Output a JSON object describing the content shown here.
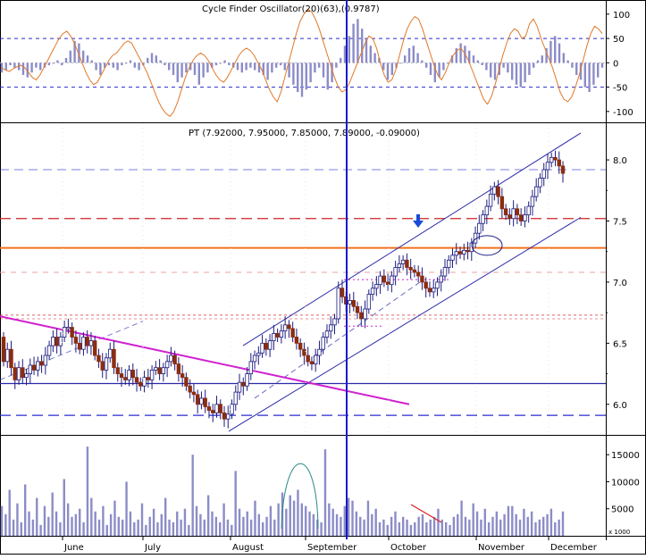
{
  "panels": {
    "oscillator": {
      "title": "Cycle Finder Oscillator(20)(63),(0.9787)",
      "yticks": [
        -100,
        -50,
        0,
        50,
        100
      ],
      "ylim": [
        -115,
        118
      ],
      "levels": [
        50,
        -50
      ]
    },
    "price": {
      "title": "PT (7.92000, 7.95000, 7.85000, 7.89000, -0.09000)",
      "yticks": [
        "6.0",
        "6.5",
        "7.0",
        "7.5",
        "8.0"
      ],
      "ylim": [
        5.75,
        8.3
      ]
    },
    "volume": {
      "yticks": [
        5000,
        10000,
        15000
      ],
      "ylim": [
        0,
        18500
      ],
      "unit": "x 1000"
    }
  },
  "x_axis": {
    "months": [
      "June",
      "July",
      "August",
      "September",
      "October",
      "November",
      "December"
    ]
  },
  "colors": {
    "up": "#ffffff",
    "down": "#8b2d10",
    "wick": "#1b1b80",
    "channel": "#2a2aa8",
    "downtrend": "#d020d0",
    "resistance": "#f0701e",
    "dashed_red": "#cc2222",
    "dashed_blue": "#2a2acc",
    "cursor": "#1a1ac8",
    "osc_line": "#e07828",
    "osc_bar": "#8c8cc8",
    "vol_bar": "#8c8cc8",
    "annotation_red": "#dd2020",
    "annotation_teal": "#2a8a8a"
  },
  "chart_data": [
    {
      "type": "bar",
      "name": "oscillator",
      "title": "Cycle Finder Oscillator(20)(63),(0.9787)",
      "ylim": [
        -115,
        118
      ],
      "line": [
        -10,
        -15,
        -18,
        -12,
        -8,
        -5,
        -10,
        -20,
        -30,
        -35,
        -25,
        -10,
        5,
        20,
        35,
        50,
        60,
        65,
        55,
        40,
        20,
        0,
        -20,
        -35,
        -45,
        -40,
        -25,
        -10,
        5,
        15,
        20,
        30,
        40,
        45,
        40,
        25,
        10,
        -5,
        -20,
        -40,
        -60,
        -80,
        -95,
        -105,
        -110,
        -100,
        -80,
        -55,
        -30,
        -10,
        5,
        15,
        20,
        15,
        5,
        -10,
        -25,
        -35,
        -40,
        -30,
        -15,
        0,
        15,
        25,
        30,
        25,
        15,
        0,
        -15,
        -35,
        -55,
        -70,
        -80,
        -60,
        -30,
        0,
        30,
        60,
        85,
        100,
        110,
        105,
        90,
        70,
        45,
        20,
        -5,
        -30,
        -50,
        -60,
        -55,
        -40,
        -20,
        0,
        20,
        40,
        55,
        50,
        30,
        0,
        -25,
        -40,
        -35,
        -15,
        15,
        45,
        70,
        85,
        95,
        90,
        70,
        45,
        20,
        -5,
        -25,
        -35,
        -20,
        0,
        15,
        25,
        30,
        20,
        5,
        -15,
        -35,
        -55,
        -75,
        -85,
        -70,
        -45,
        -15,
        15,
        40,
        60,
        70,
        65,
        50,
        55,
        80,
        90,
        75,
        50,
        30,
        10,
        -10,
        -35,
        -60,
        -75,
        -80,
        -70,
        -50,
        -25,
        5,
        35,
        60,
        75,
        70,
        60
      ],
      "bars": [
        -20,
        -15,
        -5,
        -10,
        -15,
        -25,
        -30,
        -20,
        -10,
        -15,
        -10,
        -5,
        0,
        5,
        -5,
        10,
        25,
        45,
        40,
        25,
        15,
        5,
        -15,
        -25,
        -10,
        -5,
        -10,
        -15,
        -5,
        0,
        5,
        -10,
        -15,
        -5,
        10,
        20,
        15,
        5,
        -5,
        -15,
        -25,
        -40,
        -30,
        -20,
        -15,
        -25,
        -45,
        -30,
        -20,
        -10,
        -5,
        0,
        5,
        -5,
        -10,
        -15,
        -20,
        -15,
        -10,
        -15,
        -20,
        -25,
        -35,
        -20,
        -10,
        -5,
        -15,
        -30,
        -45,
        -60,
        -70,
        -55,
        -40,
        -20,
        -10,
        -30,
        -55,
        -40,
        -10,
        10,
        35,
        55,
        80,
        90,
        70,
        50,
        35,
        20,
        10,
        -15,
        -35,
        -25,
        -10,
        0,
        15,
        30,
        35,
        20,
        5,
        -10,
        -25,
        -40,
        -30,
        -15,
        0,
        15,
        30,
        40,
        35,
        25,
        15,
        5,
        -5,
        -15,
        -30,
        -35,
        -25,
        -10,
        -20,
        -35,
        -45,
        -50,
        -40,
        -25,
        -10,
        5,
        15,
        30,
        45,
        55,
        40,
        20,
        5,
        -10,
        -25,
        -35,
        -50,
        -60,
        -45,
        -30,
        -10
      ]
    },
    {
      "type": "candlestick",
      "name": "price",
      "title": "PT (7.92000, 7.95000, 7.85000, 7.89000, -0.09000)",
      "ylim": [
        5.75,
        8.3
      ],
      "open": [
        6.55,
        6.35,
        6.45,
        6.3,
        6.2,
        6.3,
        6.22,
        6.25,
        6.32,
        6.28,
        6.35,
        6.32,
        6.4,
        6.48,
        6.55,
        6.48,
        6.55,
        6.63,
        6.63,
        6.55,
        6.5,
        6.45,
        6.55,
        6.48,
        6.52,
        6.4,
        6.35,
        6.28,
        6.38,
        6.45,
        6.3,
        6.25,
        6.22,
        6.2,
        6.28,
        6.22,
        6.18,
        6.15,
        6.22,
        6.2,
        6.28,
        6.3,
        6.25,
        6.3,
        6.35,
        6.4,
        6.33,
        6.25,
        6.22,
        6.15,
        6.1,
        6.08,
        6.0,
        6.05,
        5.98,
        5.95,
        5.93,
        6.0,
        5.93,
        5.88,
        5.92,
        6.0,
        6.1,
        6.18,
        6.15,
        6.25,
        6.35,
        6.4,
        6.42,
        6.5,
        6.45,
        6.52,
        6.58,
        6.55,
        6.6,
        6.65,
        6.62,
        6.55,
        6.5,
        6.45,
        6.4,
        6.35,
        6.33,
        6.4,
        6.45,
        6.55,
        6.6,
        6.65,
        6.7,
        6.95,
        6.88,
        6.82,
        6.85,
        6.8,
        6.75,
        6.7,
        6.78,
        6.9,
        6.95,
        6.98,
        7.05,
        7.0,
        6.98,
        7.05,
        7.12,
        7.15,
        7.18,
        7.12,
        7.1,
        7.08,
        7.05,
        7.0,
        6.95,
        6.92,
        6.95,
        7.0,
        7.05,
        7.12,
        7.18,
        7.22,
        7.25,
        7.23,
        7.26,
        7.25,
        7.32,
        7.4,
        7.48,
        7.55,
        7.62,
        7.72,
        7.78,
        7.7,
        7.6,
        7.55,
        7.52,
        7.6,
        7.55,
        7.5,
        7.55,
        7.62,
        7.7,
        7.78,
        7.85,
        7.92,
        7.98,
        8.02,
        8.0,
        7.95
      ],
      "close": [
        6.35,
        6.45,
        6.3,
        6.2,
        6.3,
        6.22,
        6.25,
        6.32,
        6.28,
        6.35,
        6.32,
        6.4,
        6.48,
        6.55,
        6.48,
        6.55,
        6.63,
        6.63,
        6.55,
        6.5,
        6.45,
        6.55,
        6.48,
        6.52,
        6.4,
        6.35,
        6.28,
        6.38,
        6.45,
        6.3,
        6.25,
        6.22,
        6.2,
        6.28,
        6.22,
        6.18,
        6.15,
        6.22,
        6.2,
        6.28,
        6.3,
        6.25,
        6.3,
        6.35,
        6.4,
        6.33,
        6.25,
        6.22,
        6.15,
        6.1,
        6.08,
        6.0,
        6.05,
        5.98,
        5.95,
        5.93,
        6.0,
        5.93,
        5.88,
        5.92,
        6.0,
        6.1,
        6.18,
        6.15,
        6.25,
        6.35,
        6.4,
        6.42,
        6.5,
        6.45,
        6.52,
        6.58,
        6.55,
        6.6,
        6.65,
        6.62,
        6.55,
        6.5,
        6.45,
        6.4,
        6.35,
        6.33,
        6.4,
        6.45,
        6.55,
        6.6,
        6.65,
        6.7,
        6.95,
        6.88,
        6.82,
        6.85,
        6.8,
        6.75,
        6.7,
        6.78,
        6.9,
        6.95,
        6.98,
        7.05,
        7.0,
        6.98,
        7.05,
        7.12,
        7.15,
        7.18,
        7.12,
        7.1,
        7.08,
        7.05,
        7.0,
        6.95,
        6.92,
        6.95,
        7.0,
        7.05,
        7.12,
        7.18,
        7.22,
        7.25,
        7.23,
        7.26,
        7.25,
        7.32,
        7.4,
        7.48,
        7.55,
        7.62,
        7.72,
        7.78,
        7.7,
        7.6,
        7.55,
        7.52,
        7.6,
        7.55,
        7.5,
        7.55,
        7.62,
        7.7,
        7.78,
        7.85,
        7.92,
        7.98,
        8.02,
        8.0,
        7.95,
        7.89
      ]
    },
    {
      "type": "bar",
      "name": "volume",
      "ylim": [
        0,
        18500
      ],
      "values": [
        5500,
        4000,
        8500,
        3000,
        6000,
        2500,
        9500,
        4500,
        3000,
        7000,
        2000,
        5500,
        3500,
        8000,
        4500,
        2500,
        10500,
        6000,
        3500,
        4000,
        5000,
        2500,
        16500,
        7000,
        4500,
        3000,
        5500,
        2000,
        4000,
        6500,
        3500,
        3000,
        10000,
        4500,
        2500,
        3000,
        6000,
        2000,
        3500,
        5000,
        2500,
        4000,
        7000,
        3000,
        2500,
        4500,
        3000,
        5000,
        2000,
        15000,
        5500,
        4000,
        3000,
        7500,
        4500,
        3500,
        2500,
        6000,
        3000,
        2000,
        12000,
        5000,
        3500,
        4500,
        3000,
        6500,
        4000,
        2500,
        3500,
        5500,
        3000,
        6000,
        8000,
        5000,
        7500,
        6500,
        8500,
        6000,
        5500,
        4500,
        4000,
        3000,
        2500,
        16000,
        6000,
        5000,
        4000,
        3500,
        5500,
        7000,
        6500,
        4500,
        3500,
        3000,
        6500,
        4000,
        5000,
        2500,
        3000,
        2000,
        3500,
        4500,
        2500,
        3500,
        3000,
        2000,
        2500,
        3500,
        4000,
        2500,
        3000,
        3500,
        5000,
        3000,
        2500,
        2000,
        3500,
        4000,
        6500,
        3500,
        3000,
        6000,
        4500,
        3000,
        5000,
        2500,
        3500,
        4500,
        3000,
        4000,
        5500,
        5500,
        4000,
        3000,
        5000,
        3500,
        4500,
        2500,
        3000,
        3500,
        4000,
        5000,
        2500,
        3000,
        4500
      ]
    }
  ]
}
